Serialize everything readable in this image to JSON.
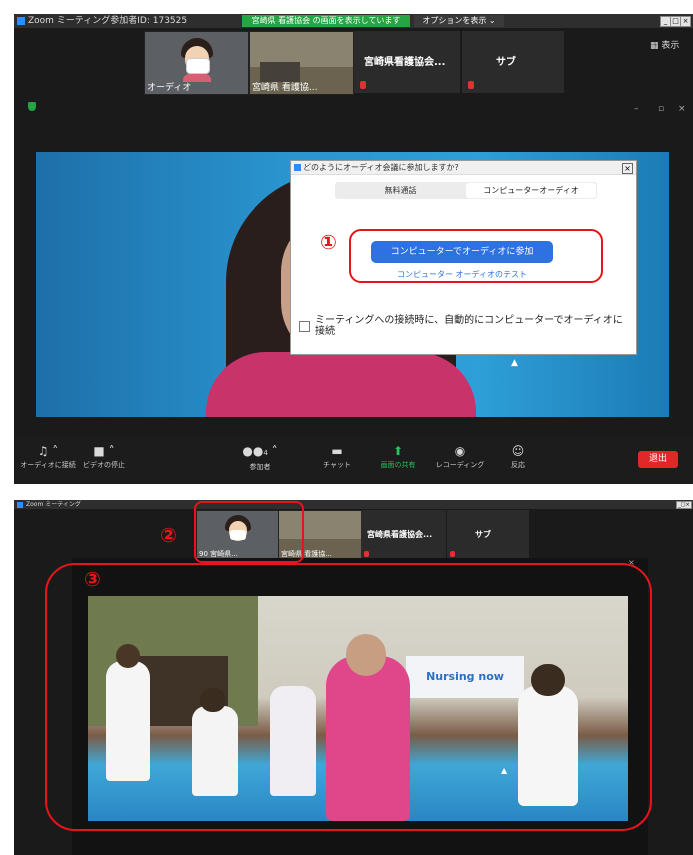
{
  "top": {
    "window_title": "Zoom ミーティング参加者ID: 173525",
    "share_banner": "宮崎県 看護協会 の画面を表示しています",
    "options_button": "オプションを表示 ⌄",
    "view_button": "表示",
    "participants": [
      {
        "label": "オーディオ"
      },
      {
        "label": "宮崎県 看護協..."
      },
      {
        "label": "宮崎県看護協会..."
      },
      {
        "label": "サブ"
      }
    ],
    "dialog": {
      "title": "どのようにオーディオ会議に参加しますか?",
      "tab_phone": "無料通話",
      "tab_computer": "コンピューターオーディオ",
      "join_button": "コンピューターでオーディオに参加",
      "test_link": "コンピューター オーディオのテスト",
      "auto_join_label": "ミーティングへの接続時に、自動的にコンピューターでオーディオに接続"
    },
    "controls": {
      "audio": "オーディオに接続",
      "video": "ビデオの停止",
      "participants": "参加者",
      "participants_count": "4",
      "chat": "チャット",
      "share": "画面の共有",
      "record": "レコーディング",
      "reactions": "反応",
      "leave": "退出"
    }
  },
  "bottom": {
    "window_title": "Zoom ミーティング",
    "participants": [
      {
        "label": "90 宮崎県..."
      },
      {
        "label": "宮崎県 看護協..."
      },
      {
        "label": "宮崎県看護協会..."
      },
      {
        "label": "サブ"
      }
    ],
    "video_sign": "Nursing now"
  },
  "annotations": {
    "n1": "①",
    "n2": "②",
    "n3": "③"
  }
}
